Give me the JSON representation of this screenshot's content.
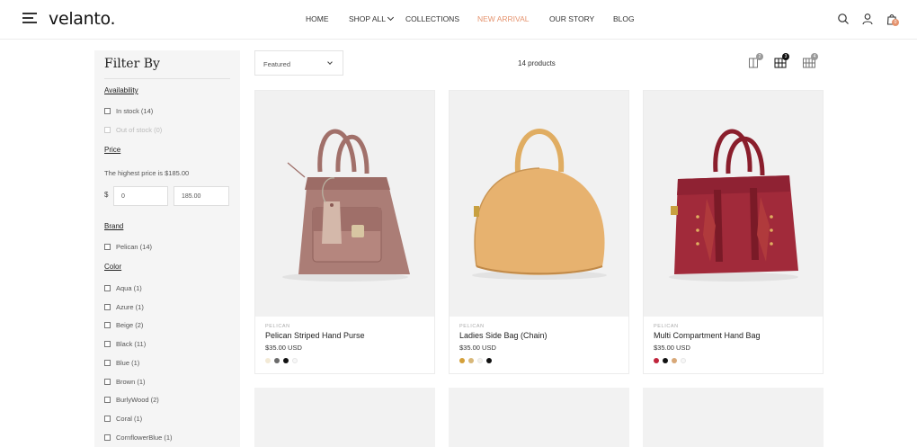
{
  "header": {
    "logo": "velanto.",
    "nav": [
      {
        "label": "HOME",
        "active": false,
        "dropdown": false
      },
      {
        "label": "SHOP ALL",
        "active": false,
        "dropdown": true
      },
      {
        "label": "COLLECTIONS",
        "active": false,
        "dropdown": false
      },
      {
        "label": "NEW ARRIVAL",
        "active": true,
        "dropdown": false
      },
      {
        "label": "OUR STORY",
        "active": false,
        "dropdown": false
      },
      {
        "label": "BLOG",
        "active": false,
        "dropdown": false
      }
    ],
    "icons": [
      "search-icon",
      "account-icon",
      "cart-icon"
    ],
    "cart_count": "0"
  },
  "sidebar": {
    "title": "Filter By",
    "availability": {
      "title": "Availability",
      "options": [
        {
          "label": "In stock (14)",
          "disabled": false
        },
        {
          "label": "Out of stock (0)",
          "disabled": true
        }
      ]
    },
    "price": {
      "title": "Price",
      "note": "The highest price is $185.00",
      "currency": "$",
      "min_value": "0",
      "max_value": "185.00"
    },
    "brand": {
      "title": "Brand",
      "options": [
        {
          "label": "Pelican (14)"
        }
      ]
    },
    "color": {
      "title": "Color",
      "options": [
        {
          "label": "Aqua (1)"
        },
        {
          "label": "Azure (1)"
        },
        {
          "label": "Beige (2)"
        },
        {
          "label": "Black (11)"
        },
        {
          "label": "Blue (1)"
        },
        {
          "label": "Brown (1)"
        },
        {
          "label": "BurlyWood (2)"
        },
        {
          "label": "Coral (1)"
        },
        {
          "label": "CornflowerBlue (1)"
        }
      ]
    }
  },
  "toolbar": {
    "sort_value": "Featured",
    "product_count": "14 products",
    "grid_options": [
      {
        "badge": "2",
        "active": false
      },
      {
        "badge": "3",
        "active": true
      },
      {
        "badge": "4",
        "active": false
      }
    ]
  },
  "products": [
    {
      "vendor": "PELICAN",
      "name": "Pelican Striped Hand Purse",
      "price": "$35.00 USD",
      "swatches": [
        "#f3ead6",
        "#6b6b6b",
        "#111111",
        "#f7f7f7"
      ]
    },
    {
      "vendor": "PELICAN",
      "name": "Ladies Side Bag (Chain)",
      "price": "$35.00 USD",
      "swatches": [
        "#d4a03a",
        "#d8b87a",
        "#f3f1ea",
        "#111111"
      ]
    },
    {
      "vendor": "PELICAN",
      "name": "Multi Compartment Hand Bag",
      "price": "$35.00 USD",
      "swatches": [
        "#c0243c",
        "#111111",
        "#d8a878",
        "#f7f7f7"
      ]
    }
  ],
  "colors": {
    "accent": "#e5936e",
    "sidebar_bg": "#f5f5f5"
  }
}
